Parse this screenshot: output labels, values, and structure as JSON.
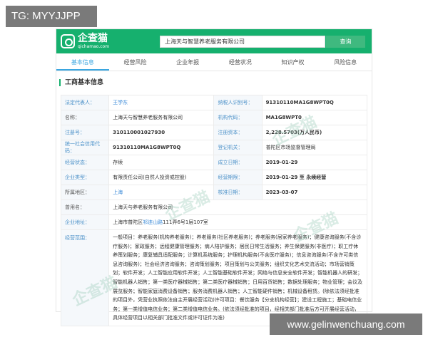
{
  "tag_label": "TG: MYYJJPP",
  "watermark_text": "www.gelinwenchuang.com",
  "header": {
    "logo_name": "企查猫",
    "logo_domain": "qichamao.com",
    "search_value": "上海天与智慧养老服务有限公司",
    "search_button": "查询",
    "bg_color": "#16b06e"
  },
  "tabs": [
    {
      "label": "基本信息",
      "active": true
    },
    {
      "label": "经营风险",
      "active": false
    },
    {
      "label": "企业年报",
      "active": false
    },
    {
      "label": "经营状况",
      "active": false
    },
    {
      "label": "知识产权",
      "active": false
    },
    {
      "label": "风险信息",
      "active": false
    }
  ],
  "section_title": "工商基本信息",
  "info": {
    "legal_rep_label": "法定代表人：",
    "legal_rep_value": "王学东",
    "taxpayer_id_label": "纳税人识别号：",
    "taxpayer_id_value": "91310110MA1G8WPT0Q",
    "name_label": "名称：",
    "name_value": "上海天与智慧养老服务有限公司",
    "org_code_label": "机构代码：",
    "org_code_value": "MA1G8WPT0",
    "reg_no_label": "注册号：",
    "reg_no_value": "310110001027930",
    "reg_capital_label": "注册资本：",
    "reg_capital_value": "2,228.5703(万人民币)",
    "credit_code_label": "统一社会信用代码：",
    "credit_code_value": "91310110MA1G8WPT0Q",
    "reg_authority_label": "登记机关：",
    "reg_authority_value": "普陀区市场监督管理局",
    "status_label": "经营状态：",
    "status_value": "存续",
    "founded_label": "成立日期：",
    "founded_value": "2019-01-29",
    "company_type_label": "企业类型：",
    "company_type_value": "有限责任公司(自然人投资或控股)",
    "term_label": "经营期限：",
    "term_value": "2019-01-29 至 永续经营",
    "region_label": "所属地区：",
    "region_value": "上海",
    "approved_label": "核准日期：",
    "approved_value": "2023-03-07",
    "former_name_label": "曾用名：",
    "former_name_value": "上海天与养老服务有限公司",
    "address_label": "企业地址：",
    "address_pre": "上海市普陀区",
    "address_hl": "祁连山路",
    "address_post": "111弄6号1层107室",
    "scope_label": "经营范围：",
    "scope_value": "一般项目：养老服务(机构养老服务)；养老服务(社区养老服务)；养老服务(居家养老服务)；健康咨询服务(不含诊疗服务)；家政服务；远程健康管理服务；病人陪护服务；居民日常生活服务；养生保健服务(非医疗)；职工疗休养策划服务；康复辅具适配服务；计算机系统服务；护理机构服务(不含医疗服务)；信息咨询服务(不含许可类信息咨询服务)；社会经济咨询服务；咨询策划服务；项目策划与公关服务；组织文化艺术交流活动；市场营销策划；软件开发；人工智能应用软件开发；人工智能基础软件开发；网络与信息安全软件开发；智能机器人的研发；智能机器人销售；第一类医疗器械销售；第二类医疗器械销售；日用百货销售；数据处理服务；物业管理；会议及展览服务；智能家庭消费设备销售；服务消费机器人销售；人工智能硬件销售；机械设备租赁。(除依法须经批准的项目外，凭营业执照依法自主开展经营活动)许可项目：餐饮服务【分支机构经营】；建设工程施工；基础电信业务；第一类增值电信业务；第二类增值电信业务。(依法须经批准的项目，经相关部门批准后方可开展经营活动，具体经营项目以相关部门批准文件或许可证件为准)"
  }
}
